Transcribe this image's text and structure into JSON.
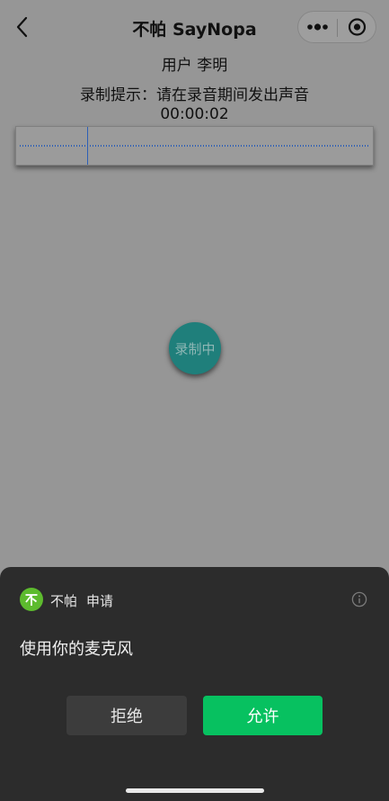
{
  "navbar": {
    "title": "不帕 SayNopa"
  },
  "user": {
    "label": "用户 李明"
  },
  "recording": {
    "hint": "录制提示：请在录音期间发出声音",
    "timer": "00:00:02",
    "button_label": "录制中"
  },
  "permission_sheet": {
    "app_name": "不帕",
    "action": "申请",
    "request": "使用你的麦克风",
    "deny_label": "拒绝",
    "allow_label": "允许"
  },
  "colors": {
    "allow_button": "#07c160",
    "record_button": "#1f7f7b",
    "sheet_background": "#2c2c2c",
    "app_logo": "#5dbb2e"
  }
}
